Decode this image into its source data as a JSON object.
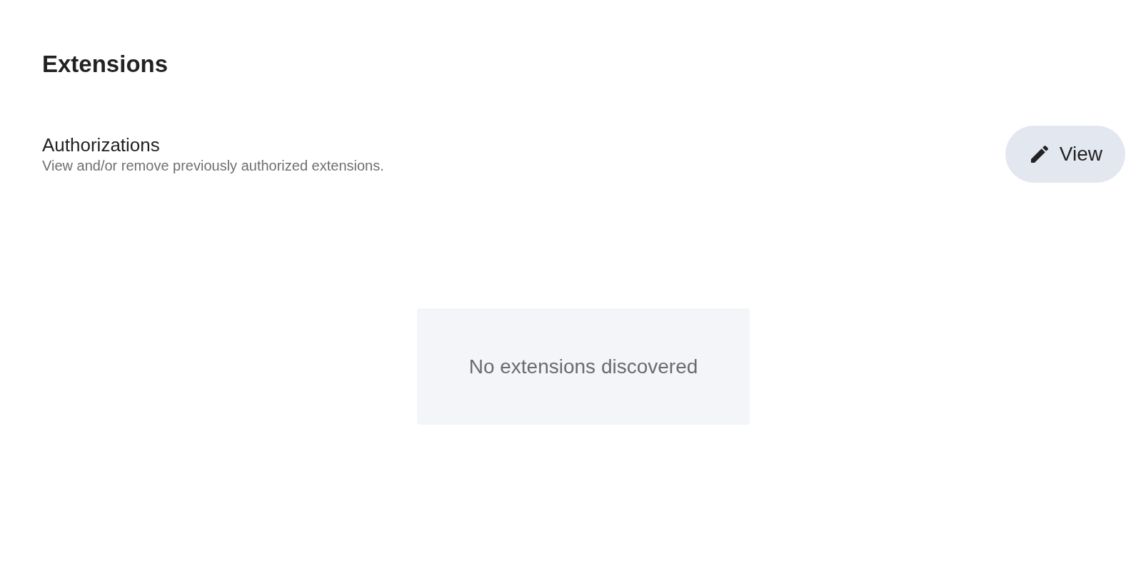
{
  "page": {
    "title": "Extensions"
  },
  "authorizations": {
    "title": "Authorizations",
    "description": "View and/or remove previously authorized extensions.",
    "button": "View"
  },
  "empty_state": {
    "message": "No extensions discovered"
  }
}
